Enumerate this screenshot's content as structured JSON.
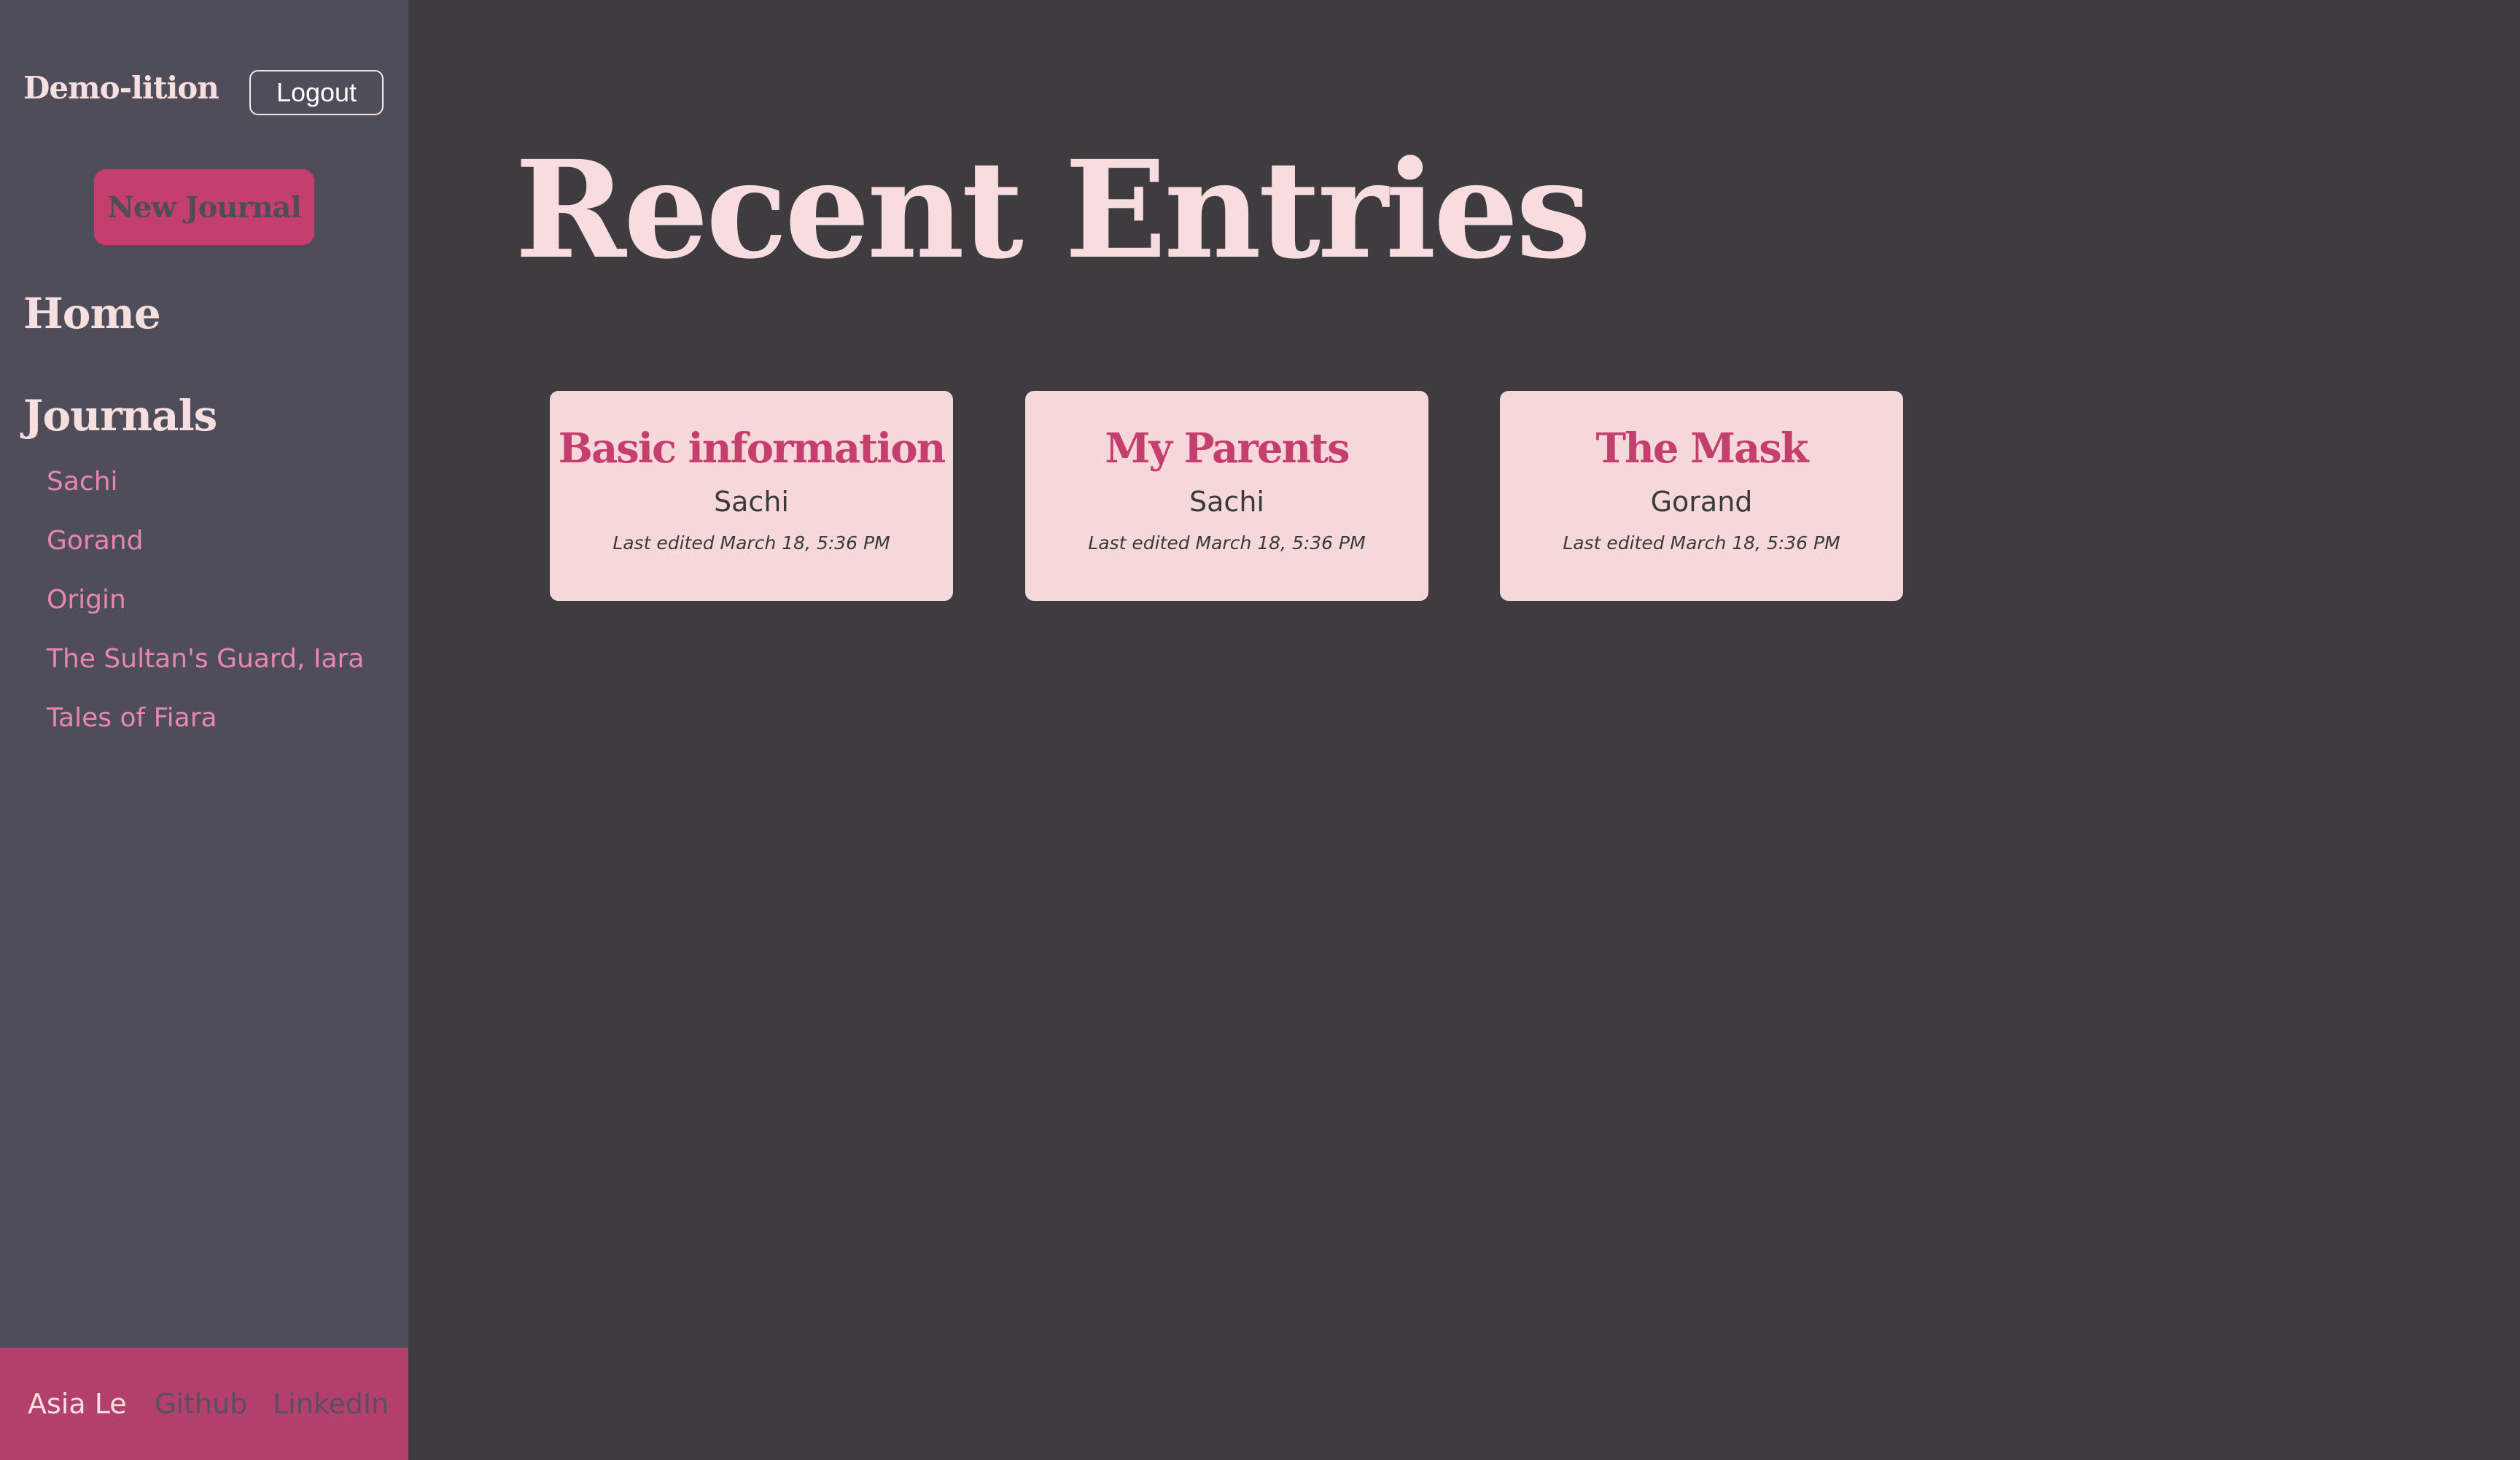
{
  "sidebar": {
    "brand": "Demo-lition",
    "logout_label": "Logout",
    "new_journal_label": "New Journal",
    "home_label": "Home",
    "journals_label": "Journals",
    "journals": [
      {
        "label": "Sachi"
      },
      {
        "label": "Gorand"
      },
      {
        "label": "Origin"
      },
      {
        "label": "The Sultan's Guard, Iara"
      },
      {
        "label": "Tales of Fiara"
      }
    ],
    "footer": {
      "author": "Asia Le",
      "github_label": "Github",
      "linkedin_label": "LinkedIn"
    }
  },
  "main": {
    "title": "Recent Entries",
    "entries": [
      {
        "title": "Basic information",
        "journal": "Sachi",
        "edited": "Last edited March 18, 5:36 PM"
      },
      {
        "title": "My Parents",
        "journal": "Sachi",
        "edited": "Last edited March 18, 5:36 PM"
      },
      {
        "title": "The Mask",
        "journal": "Gorand",
        "edited": "Last edited March 18, 5:36 PM"
      }
    ]
  },
  "colors": {
    "sidebar_bg": "#4f4d59",
    "main_bg": "#3e3c3f",
    "accent": "#c53f6e",
    "card_bg": "#f6d8db",
    "link": "#e887ad",
    "footer_bg": "#b3406c"
  }
}
